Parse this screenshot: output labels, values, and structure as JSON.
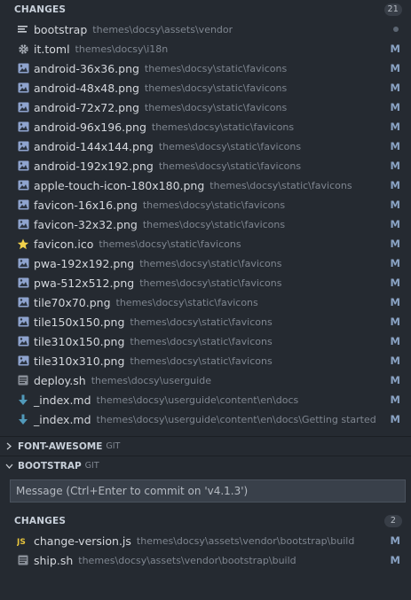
{
  "changes": {
    "title": "CHANGES",
    "count": "21",
    "files": [
      {
        "name": "bootstrap",
        "path": "themes\\docsy\\assets\\vendor",
        "status": "",
        "icon": "lines-icon"
      },
      {
        "name": "it.toml",
        "path": "themes\\docsy\\i18n",
        "status": "M",
        "icon": "gear-icon"
      },
      {
        "name": "android-36x36.png",
        "path": "themes\\docsy\\static\\favicons",
        "status": "M",
        "icon": "image-icon"
      },
      {
        "name": "android-48x48.png",
        "path": "themes\\docsy\\static\\favicons",
        "status": "M",
        "icon": "image-icon"
      },
      {
        "name": "android-72x72.png",
        "path": "themes\\docsy\\static\\favicons",
        "status": "M",
        "icon": "image-icon"
      },
      {
        "name": "android-96x196.png",
        "path": "themes\\docsy\\static\\favicons",
        "status": "M",
        "icon": "image-icon"
      },
      {
        "name": "android-144x144.png",
        "path": "themes\\docsy\\static\\favicons",
        "status": "M",
        "icon": "image-icon"
      },
      {
        "name": "android-192x192.png",
        "path": "themes\\docsy\\static\\favicons",
        "status": "M",
        "icon": "image-icon"
      },
      {
        "name": "apple-touch-icon-180x180.png",
        "path": "themes\\docsy\\static\\favicons",
        "status": "M",
        "icon": "image-icon"
      },
      {
        "name": "favicon-16x16.png",
        "path": "themes\\docsy\\static\\favicons",
        "status": "M",
        "icon": "image-icon"
      },
      {
        "name": "favicon-32x32.png",
        "path": "themes\\docsy\\static\\favicons",
        "status": "M",
        "icon": "image-icon"
      },
      {
        "name": "favicon.ico",
        "path": "themes\\docsy\\static\\favicons",
        "status": "M",
        "icon": "star-icon"
      },
      {
        "name": "pwa-192x192.png",
        "path": "themes\\docsy\\static\\favicons",
        "status": "M",
        "icon": "image-icon"
      },
      {
        "name": "pwa-512x512.png",
        "path": "themes\\docsy\\static\\favicons",
        "status": "M",
        "icon": "image-icon"
      },
      {
        "name": "tile70x70.png",
        "path": "themes\\docsy\\static\\favicons",
        "status": "M",
        "icon": "image-icon"
      },
      {
        "name": "tile150x150.png",
        "path": "themes\\docsy\\static\\favicons",
        "status": "M",
        "icon": "image-icon"
      },
      {
        "name": "tile310x150.png",
        "path": "themes\\docsy\\static\\favicons",
        "status": "M",
        "icon": "image-icon"
      },
      {
        "name": "tile310x310.png",
        "path": "themes\\docsy\\static\\favicons",
        "status": "M",
        "icon": "image-icon"
      },
      {
        "name": "deploy.sh",
        "path": "themes\\docsy\\userguide",
        "status": "M",
        "icon": "shell-icon"
      },
      {
        "name": "_index.md",
        "path": "themes\\docsy\\userguide\\content\\en\\docs",
        "status": "M",
        "icon": "markdown-icon"
      },
      {
        "name": "_index.md",
        "path": "themes\\docsy\\userguide\\content\\en\\docs\\Getting started",
        "status": "M",
        "icon": "markdown-icon"
      }
    ]
  },
  "providers": [
    {
      "name": "FONT-AWESOME",
      "tag": "GIT",
      "expanded": false
    },
    {
      "name": "BOOTSTRAP",
      "tag": "GIT",
      "expanded": true
    }
  ],
  "commit": {
    "placeholder": "Message (Ctrl+Enter to commit on 'v4.1.3')"
  },
  "bootstrap_changes": {
    "title": "CHANGES",
    "count": "2",
    "files": [
      {
        "name": "change-version.js",
        "path": "themes\\docsy\\assets\\vendor\\bootstrap\\build",
        "status": "M",
        "icon": "js-icon"
      },
      {
        "name": "ship.sh",
        "path": "themes\\docsy\\assets\\vendor\\bootstrap\\build",
        "status": "M",
        "icon": "shell-icon"
      }
    ]
  },
  "colors": {
    "background": "#252a31",
    "image_icon": "#8fa4cf",
    "markdown_icon": "#519aba",
    "star_icon": "#f1d14b",
    "js_icon": "#e8c53c",
    "modified_status": "#8aa3c4"
  }
}
